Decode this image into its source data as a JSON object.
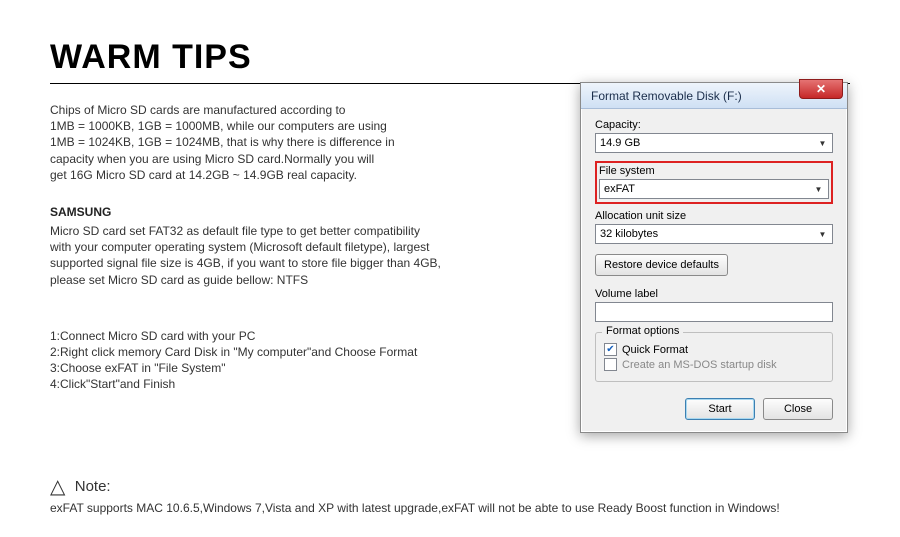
{
  "title": "WARM TIPS",
  "para1": "Chips of Micro SD cards are manufactured according to\n1MB = 1000KB, 1GB = 1000MB, while our computers are using\n1MB = 1024KB, 1GB = 1024MB, that is why there is difference in\ncapacity when you are using Micro SD card.Normally you will\nget 16G Micro SD card at 14.2GB ~ 14.9GB real capacity.",
  "brand": "SAMSUNG",
  "para2": "Micro SD card set FAT32 as default file type to get better compatibility\nwith your computer operating system (Microsoft default filetype), largest\nsupported signal file size is 4GB, if you want to store file bigger than 4GB,\nplease set Micro SD card as guide bellow: NTFS",
  "steps": "1:Connect Micro SD card with your PC\n2:Right click memory Card Disk in \"My computer\"and Choose Format\n3:Choose exFAT in \"File System\"\n4:Click\"Start\"and Finish",
  "note_label": "Note:",
  "note_text": "exFAT supports MAC 10.6.5,Windows 7,Vista and XP with latest upgrade,exFAT will not be abte to use Ready Boost function in Windows!",
  "dialog": {
    "title": "Format Removable Disk (F:)",
    "capacity_label": "Capacity:",
    "capacity_value": "14.9 GB",
    "fs_label": "File system",
    "fs_value": "exFAT",
    "alloc_label": "Allocation unit size",
    "alloc_value": "32 kilobytes",
    "restore": "Restore device defaults",
    "vol_label": "Volume label",
    "vol_value": "",
    "format_options": "Format options",
    "quick_format": "Quick Format",
    "msdos": "Create an MS-DOS startup disk",
    "start": "Start",
    "close": "Close"
  }
}
